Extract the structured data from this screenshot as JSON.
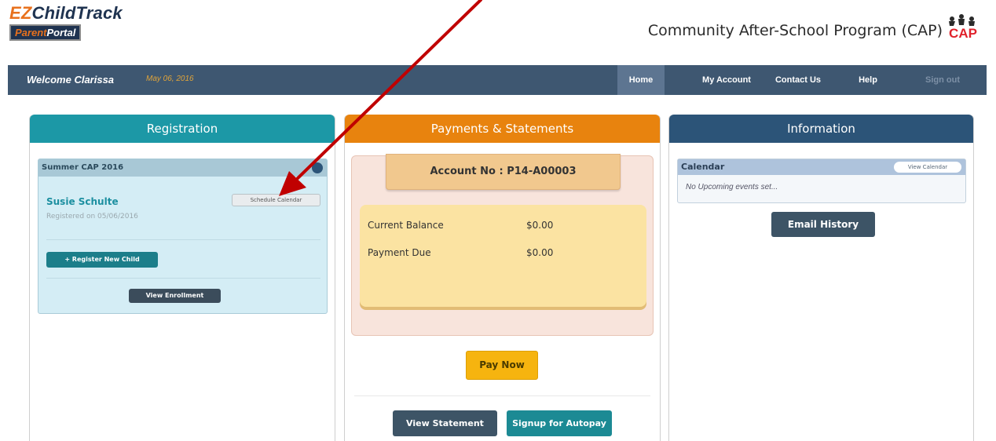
{
  "brand": {
    "name_ez": "EZ",
    "name_rest": "ChildTrack",
    "portal_parent": "Parent",
    "portal_rest": "Portal"
  },
  "program": {
    "title": "Community After-School Program (CAP)",
    "logo_icon": "cap-logo"
  },
  "navbar": {
    "welcome": "Welcome Clarissa",
    "date": "May 06, 2016",
    "items": [
      {
        "label": "Home",
        "active": true
      },
      {
        "label": "My Account"
      },
      {
        "label": "Contact Us"
      },
      {
        "label": "Help"
      },
      {
        "label": "Sign out",
        "disabled": true
      }
    ]
  },
  "registration": {
    "title": "Registration",
    "program_name": "Summer CAP 2016",
    "child_name": "Susie Schulte",
    "registered_text": "Registered on 05/06/2016",
    "schedule_button": "Schedule Calendar",
    "register_button": "+ Register New Child",
    "enrollment_button": "View Enrollment"
  },
  "payments": {
    "title": "Payments & Statements",
    "account_label": "Account No : P14-A00003",
    "rows": [
      {
        "label": "Current Balance",
        "value": "$0.00"
      },
      {
        "label": "Payment Due",
        "value": "$0.00"
      }
    ],
    "pay_now_button": "Pay Now",
    "statement_button": "View Statement",
    "autopay_button": "Signup for Autopay"
  },
  "information": {
    "title": "Information",
    "calendar_title": "Calendar",
    "view_calendar_button": "View Calendar",
    "empty_text": "No Upcoming events set...",
    "email_history_button": "Email History"
  },
  "colors": {
    "navbar": "#3e5771",
    "registration": "#1c98a6",
    "payments": "#e8830e",
    "information": "#2c5478",
    "annotation_arrow": "#c00000"
  }
}
